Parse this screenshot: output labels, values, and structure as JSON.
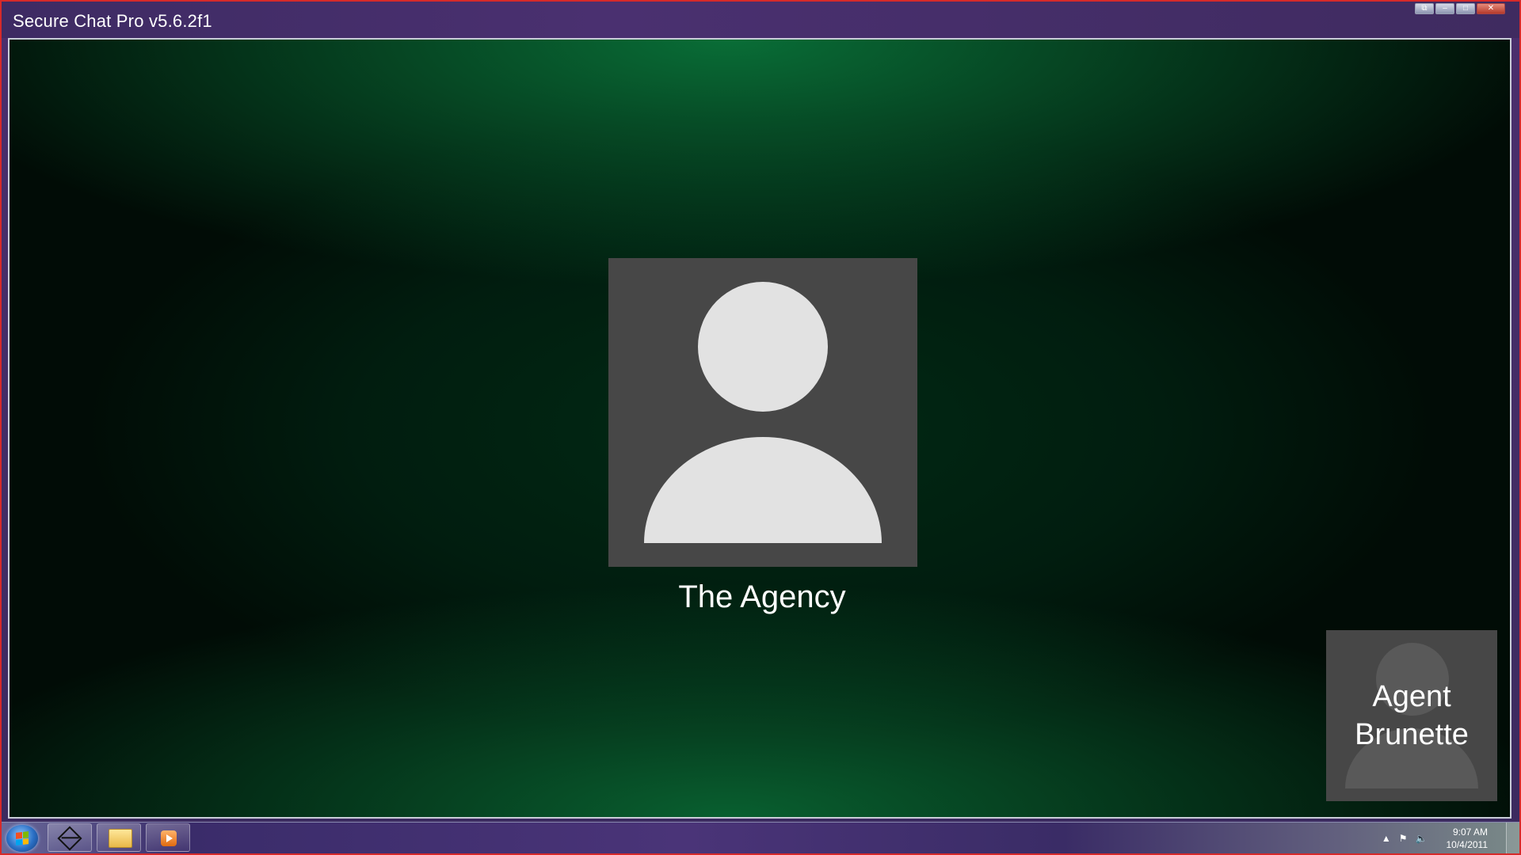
{
  "window": {
    "title": "Secure Chat Pro v5.6.2f1",
    "controls": {
      "restore": "⧉",
      "minimize": "–",
      "maximize": "□",
      "close": "✕"
    }
  },
  "call": {
    "remote_name": "The Agency",
    "local_name": "Agent Brunette"
  },
  "taskbar": {
    "pinned": [
      {
        "name": "secure-chat-app",
        "icon": "diamond-icon"
      },
      {
        "name": "windows-explorer",
        "icon": "folder-icon"
      },
      {
        "name": "media-player",
        "icon": "play-icon"
      }
    ],
    "tray": {
      "show_hidden": "▲",
      "flag": "⚑",
      "volume": "🔈"
    },
    "clock": {
      "time": "9:07 AM",
      "date": "10/4/2011"
    }
  },
  "colors": {
    "titlebar": "#3e2b63",
    "background_green": "#0a783c",
    "avatar_bg": "#474747",
    "avatar_fg": "#e2e2e2"
  }
}
